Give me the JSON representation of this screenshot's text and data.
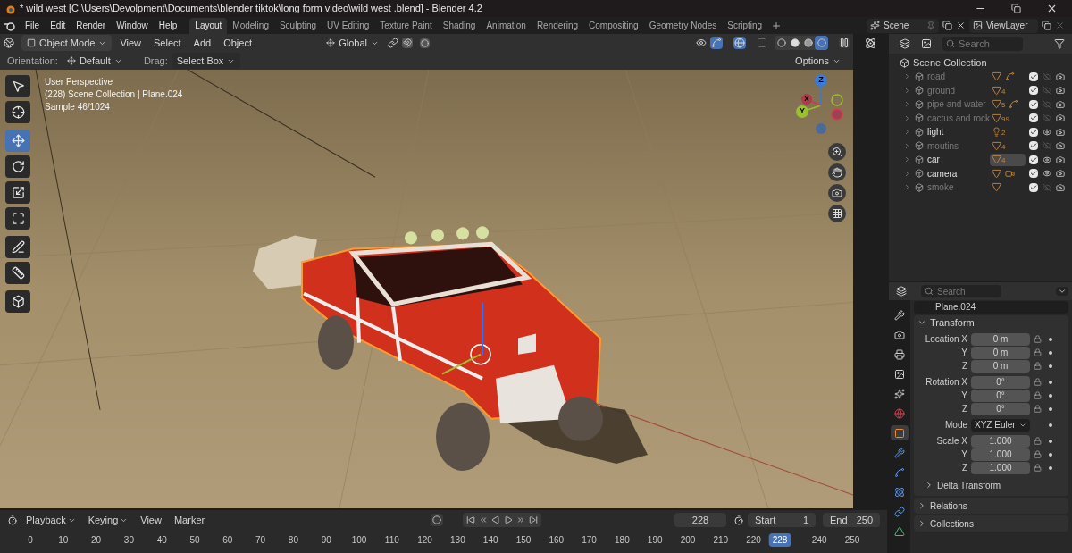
{
  "window": {
    "title": "* wild west  [C:\\Users\\Devolpment\\Documents\\blender tiktok\\long form video\\wild west .blend] - Blender 4.2"
  },
  "menu": [
    "File",
    "Edit",
    "Render",
    "Window",
    "Help"
  ],
  "workspaces": [
    {
      "label": "Layout",
      "selected": true
    },
    {
      "label": "Modeling",
      "selected": false
    },
    {
      "label": "Sculpting",
      "selected": false
    },
    {
      "label": "UV Editing",
      "selected": false
    },
    {
      "label": "Texture Paint",
      "selected": false
    },
    {
      "label": "Shading",
      "selected": false
    },
    {
      "label": "Animation",
      "selected": false
    },
    {
      "label": "Rendering",
      "selected": false
    },
    {
      "label": "Compositing",
      "selected": false
    },
    {
      "label": "Geometry Nodes",
      "selected": false
    },
    {
      "label": "Scripting",
      "selected": false
    }
  ],
  "scene": "Scene",
  "view_layer": "ViewLayer",
  "viewport": {
    "mode": "Object Mode",
    "menus": [
      "View",
      "Select",
      "Add",
      "Object"
    ],
    "transform_orientation": "Global",
    "orientation_label": "Orientation:",
    "orientation": "Default",
    "drag_label": "Drag:",
    "drag": "Select Box",
    "options": "Options",
    "overlay_lines": [
      "User Perspective",
      "(228) Scene Collection | Plane.024",
      "Sample 46/1024"
    ],
    "tools": [
      {
        "kind": "select",
        "selected": false
      },
      {
        "kind": "cursor",
        "selected": false
      },
      {
        "kind": "move",
        "selected": true
      },
      {
        "kind": "rotate",
        "selected": false
      },
      {
        "kind": "scale",
        "selected": false
      },
      {
        "kind": "transform",
        "selected": false
      },
      {
        "kind": "annotate",
        "selected": false
      },
      {
        "kind": "measure",
        "selected": false
      },
      {
        "kind": "add",
        "selected": false
      }
    ],
    "shading": [
      {
        "kind": "wireframe",
        "selected": false
      },
      {
        "kind": "solid",
        "selected": false
      },
      {
        "kind": "material",
        "selected": false
      },
      {
        "kind": "rendered",
        "selected": true
      }
    ],
    "gizmo": {
      "z": "Z",
      "y": "Y",
      "x": "X"
    }
  },
  "outliner": {
    "search_placeholder": "Search",
    "root": "Scene Collection",
    "items": [
      {
        "name": "road",
        "visible": false,
        "checked": true,
        "selected": false,
        "badges": [
          {
            "kind": "mesh"
          },
          {
            "kind": "curve"
          }
        ]
      },
      {
        "name": "ground",
        "visible": false,
        "checked": true,
        "selected": false,
        "badges": [
          {
            "kind": "mesh",
            "count": "4"
          }
        ]
      },
      {
        "name": "pipe and water",
        "visible": false,
        "checked": true,
        "selected": false,
        "badges": [
          {
            "kind": "mesh",
            "count": "5"
          },
          {
            "kind": "curve"
          }
        ]
      },
      {
        "name": "cactus and rock",
        "visible": false,
        "checked": true,
        "selected": false,
        "badges": [
          {
            "kind": "mesh",
            "count": "99"
          }
        ]
      },
      {
        "name": "light",
        "visible": true,
        "checked": true,
        "selected": false,
        "badges": [
          {
            "kind": "light",
            "count": "2"
          }
        ]
      },
      {
        "name": "moutins",
        "visible": false,
        "checked": true,
        "selected": false,
        "badges": [
          {
            "kind": "mesh",
            "count": "4"
          }
        ]
      },
      {
        "name": "car",
        "visible": true,
        "checked": true,
        "selected": true,
        "badges": [
          {
            "kind": "mesh",
            "count": "4"
          }
        ]
      },
      {
        "name": "camera",
        "visible": true,
        "checked": true,
        "selected": false,
        "badges": [
          {
            "kind": "mesh"
          },
          {
            "kind": "camera"
          }
        ]
      },
      {
        "name": "smoke",
        "visible": false,
        "checked": true,
        "selected": false,
        "badges": [
          {
            "kind": "mesh"
          }
        ]
      }
    ]
  },
  "properties": {
    "search_placeholder": "Search",
    "object_name": "Plane.024",
    "tabs": [
      {
        "kind": "tool",
        "selected": false
      },
      {
        "kind": "render",
        "selected": false
      },
      {
        "kind": "output",
        "selected": false
      },
      {
        "kind": "view_layer",
        "selected": false
      },
      {
        "kind": "scene",
        "selected": false
      },
      {
        "kind": "world",
        "selected": false
      },
      {
        "kind": "object",
        "selected": true
      },
      {
        "kind": "modifiers",
        "selected": false
      },
      {
        "kind": "particles",
        "selected": false
      },
      {
        "kind": "physics",
        "selected": false
      },
      {
        "kind": "constraints",
        "selected": false
      },
      {
        "kind": "data",
        "selected": false
      }
    ],
    "transform": {
      "title": "Transform",
      "expanded": true,
      "groups": [
        {
          "rows": [
            {
              "kind": "field",
              "label": "Location X",
              "value": "0 m"
            },
            {
              "kind": "field",
              "label": "Y",
              "value": "0 m"
            },
            {
              "kind": "field",
              "label": "Z",
              "value": "0 m"
            }
          ]
        },
        {
          "rows": [
            {
              "kind": "field",
              "label": "Rotation X",
              "value": "0°"
            },
            {
              "kind": "field",
              "label": "Y",
              "value": "0°"
            },
            {
              "kind": "field",
              "label": "Z",
              "value": "0°"
            }
          ]
        },
        {
          "rows": [
            {
              "kind": "dropdown",
              "label": "Mode",
              "value": "XYZ Euler"
            }
          ]
        },
        {
          "rows": [
            {
              "kind": "field",
              "label": "Scale X",
              "value": "1.000"
            },
            {
              "kind": "field",
              "label": "Y",
              "value": "1.000"
            },
            {
              "kind": "field",
              "label": "Z",
              "value": "1.000"
            }
          ]
        }
      ],
      "subpanel": {
        "title": "Delta Transform",
        "expanded": false
      }
    },
    "panels": [
      {
        "title": "Relations",
        "expanded": false
      },
      {
        "title": "Collections",
        "expanded": false
      }
    ]
  },
  "timeline": {
    "menus": [
      {
        "label": "Playback",
        "dropdown": true
      },
      {
        "label": "Keying",
        "dropdown": true
      },
      {
        "label": "View",
        "dropdown": false
      },
      {
        "label": "Marker",
        "dropdown": false
      }
    ],
    "current_frame": "228",
    "start_label": "Start",
    "start": "1",
    "end_label": "End",
    "end": "250",
    "ticks": [
      {
        "label": "0",
        "current": false
      },
      {
        "label": "10",
        "current": false
      },
      {
        "label": "20",
        "current": false
      },
      {
        "label": "30",
        "current": false
      },
      {
        "label": "40",
        "current": false
      },
      {
        "label": "50",
        "current": false
      },
      {
        "label": "60",
        "current": false
      },
      {
        "label": "70",
        "current": false
      },
      {
        "label": "80",
        "current": false
      },
      {
        "label": "90",
        "current": false
      },
      {
        "label": "100",
        "current": false
      },
      {
        "label": "110",
        "current": false
      },
      {
        "label": "120",
        "current": false
      },
      {
        "label": "130",
        "current": false
      },
      {
        "label": "140",
        "current": false
      },
      {
        "label": "150",
        "current": false
      },
      {
        "label": "160",
        "current": false
      },
      {
        "label": "170",
        "current": false
      },
      {
        "label": "180",
        "current": false
      },
      {
        "label": "190",
        "current": false
      },
      {
        "label": "200",
        "current": false
      },
      {
        "label": "210",
        "current": false
      },
      {
        "label": "220",
        "current": false
      },
      {
        "label": "228",
        "current": true
      },
      {
        "label": "240",
        "current": false
      },
      {
        "label": "250",
        "current": false
      }
    ]
  }
}
